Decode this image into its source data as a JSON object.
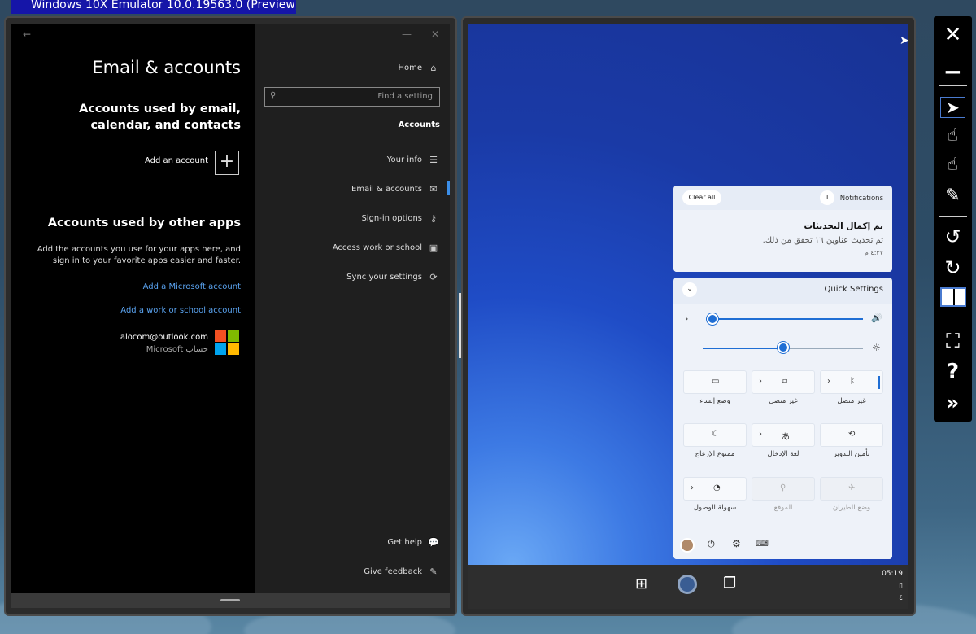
{
  "emulator": {
    "window_title": "Windows 10X Emulator 10.0.19563.0 (Preview)"
  },
  "settings": {
    "page_title": "Email & accounts",
    "section1_title": "Accounts used by email, calendar, and contacts",
    "add_account_label": "Add an account",
    "section2_title": "Accounts used by other apps",
    "section2_desc": "Add the accounts you use for your apps here, and sign in to your favorite apps easier and faster.",
    "link_microsoft": "Add a Microsoft account",
    "link_work": "Add a work or school account",
    "account_email": "alocom@outlook.com",
    "account_type": "Microsoft حساب",
    "nav": {
      "home": "Home",
      "search_placeholder": "Find a setting",
      "section": "Accounts",
      "items": [
        "Your info",
        "Email & accounts",
        "Sign-in options",
        "Access work or school",
        "Sync your settings"
      ],
      "get_help": "Get help",
      "give_feedback": "Give feedback"
    }
  },
  "notifications": {
    "clear_all": "Clear all",
    "count": "1",
    "header": "Notifications",
    "title": "تم إكمال التحديثات",
    "body": "تم تحديث عناوين ١٦ تحقق من ذلك.",
    "time": "٤:٣٧ م"
  },
  "quick_settings": {
    "title": "Quick Settings",
    "volume_pct": 4,
    "brightness_pct": 50,
    "tiles": [
      {
        "label": "وضع إنشاء",
        "icon": "tablet-icon",
        "chevron": false,
        "disabled": false
      },
      {
        "label": "غير متصل",
        "icon": "project-icon",
        "chevron": true,
        "disabled": false
      },
      {
        "label": "غير متصل",
        "icon": "bluetooth-icon",
        "chevron": true,
        "disabled": false
      },
      {
        "label": "ممنوع الإزعاج",
        "icon": "moon-icon",
        "chevron": false,
        "disabled": false
      },
      {
        "label": "لغة الإدخال",
        "icon": "keyboard-language-icon",
        "chevron": true,
        "disabled": false
      },
      {
        "label": "تأمين التدوير",
        "icon": "rotation-lock-icon",
        "chevron": false,
        "disabled": false
      },
      {
        "label": "سهولة الوصول",
        "icon": "accessibility-icon",
        "chevron": true,
        "disabled": false
      },
      {
        "label": "الموقع",
        "icon": "location-icon",
        "chevron": false,
        "disabled": true
      },
      {
        "label": "وضع الطيران",
        "icon": "airplane-icon",
        "chevron": false,
        "disabled": true
      }
    ]
  },
  "taskbar": {
    "time": "05:19",
    "date": "٤"
  }
}
